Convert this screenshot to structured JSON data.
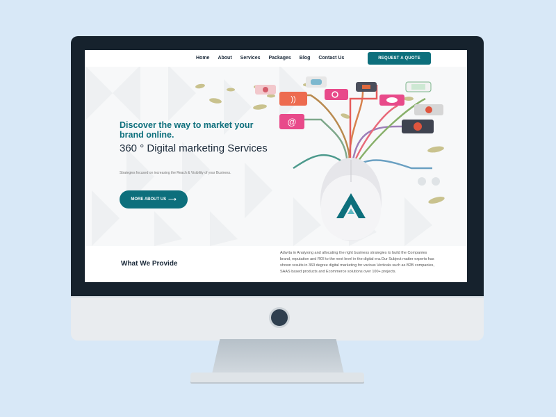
{
  "nav": {
    "links": [
      "Home",
      "About",
      "Services",
      "Packages",
      "Blog",
      "Contact Us"
    ],
    "cta_label": "REQUEST A QUOTE"
  },
  "hero": {
    "tagline": "Discover the way to market your brand online.",
    "title": "360 ° Digital marketing Services",
    "description": "Strategies focused on increasing the Reach & Visibility of your Business.",
    "button_label": "MORE ABOUT US",
    "button_arrow": "⟶"
  },
  "section": {
    "title": "What We Provide",
    "description": "Adwrta in Analysing and allocating the right business strategies to build the Companies brand, reputation and ROI to the next level in the digital era.Our Subject matter experts has shown results in 360 degree digital marketing for various Verticals such as B2B companies, SAAS based products and Ecommerce solutions over 100+ projects."
  },
  "colors": {
    "brand": "#0d6f7c",
    "dark_text": "#1b2a3a",
    "background": "#d8e8f7",
    "monitor_frame": "#16222d"
  },
  "icons": [
    "rss-icon",
    "at-sign-icon",
    "user-icon",
    "chat-icon",
    "mail-icon",
    "video-icon",
    "heart-icon",
    "map-pin-icon",
    "cart-icon",
    "search-icon",
    "computer-mouse-icon",
    "brand-logo-icon",
    "arrow-right-icon"
  ]
}
